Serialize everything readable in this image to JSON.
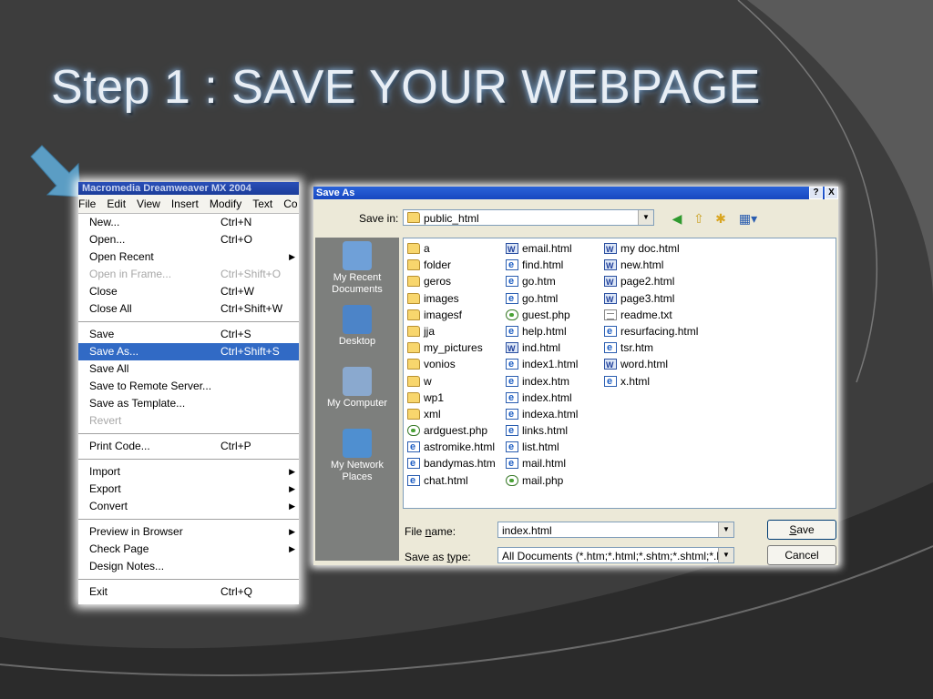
{
  "slide": {
    "title": "Step 1 : SAVE YOUR WEBPAGE"
  },
  "menu": {
    "app_title": "Macromedia Dreamweaver MX 2004",
    "menubar": [
      "File",
      "Edit",
      "View",
      "Insert",
      "Modify",
      "Text",
      "Co"
    ],
    "groups": [
      [
        {
          "label": "New...",
          "shortcut": "Ctrl+N"
        },
        {
          "label": "Open...",
          "shortcut": "Ctrl+O"
        },
        {
          "label": "Open Recent",
          "shortcut": "",
          "submenu": true
        },
        {
          "label": "Open in Frame...",
          "shortcut": "Ctrl+Shift+O",
          "disabled": true
        },
        {
          "label": "Close",
          "shortcut": "Ctrl+W"
        },
        {
          "label": "Close All",
          "shortcut": "Ctrl+Shift+W"
        }
      ],
      [
        {
          "label": "Save",
          "shortcut": "Ctrl+S"
        },
        {
          "label": "Save As...",
          "shortcut": "Ctrl+Shift+S",
          "selected": true
        },
        {
          "label": "Save All",
          "shortcut": ""
        },
        {
          "label": "Save to Remote Server...",
          "shortcut": ""
        },
        {
          "label": "Save as Template...",
          "shortcut": ""
        },
        {
          "label": "Revert",
          "shortcut": "",
          "disabled": true
        }
      ],
      [
        {
          "label": "Print Code...",
          "shortcut": "Ctrl+P"
        }
      ],
      [
        {
          "label": "Import",
          "shortcut": "",
          "submenu": true
        },
        {
          "label": "Export",
          "shortcut": "",
          "submenu": true
        },
        {
          "label": "Convert",
          "shortcut": "",
          "submenu": true
        }
      ],
      [
        {
          "label": "Preview in Browser",
          "shortcut": "",
          "submenu": true
        },
        {
          "label": "Check Page",
          "shortcut": "",
          "submenu": true
        },
        {
          "label": "Design Notes...",
          "shortcut": ""
        }
      ],
      [
        {
          "label": "Exit",
          "shortcut": "Ctrl+Q"
        }
      ]
    ]
  },
  "dialog": {
    "title": "Save As",
    "title_buttons": [
      "?",
      "X"
    ],
    "save_in_label": "Save in:",
    "save_in_value": "public_html",
    "places": [
      {
        "label": "My Recent Documents",
        "icon": "recent-documents-icon"
      },
      {
        "label": "Desktop",
        "icon": "desktop-icon"
      },
      {
        "label": "My Computer",
        "icon": "my-computer-icon"
      },
      {
        "label": "My Network Places",
        "icon": "network-places-icon"
      }
    ],
    "files": [
      [
        {
          "name": "a",
          "type": "folder"
        },
        {
          "name": "folder",
          "type": "folder"
        },
        {
          "name": "geros",
          "type": "folder"
        },
        {
          "name": "images",
          "type": "folder"
        },
        {
          "name": "imagesf",
          "type": "folder"
        },
        {
          "name": "jja",
          "type": "folder"
        },
        {
          "name": "my_pictures",
          "type": "folder"
        },
        {
          "name": "vonios",
          "type": "folder"
        },
        {
          "name": "w",
          "type": "folder"
        },
        {
          "name": "wp1",
          "type": "folder"
        },
        {
          "name": "xml",
          "type": "folder"
        },
        {
          "name": "ardguest.php",
          "type": "php"
        },
        {
          "name": "astromike.html",
          "type": "html"
        },
        {
          "name": "bandymas.htm",
          "type": "html"
        },
        {
          "name": "chat.html",
          "type": "html"
        }
      ],
      [
        {
          "name": "email.html",
          "type": "word"
        },
        {
          "name": "find.html",
          "type": "html"
        },
        {
          "name": "go.htm",
          "type": "html"
        },
        {
          "name": "go.html",
          "type": "html"
        },
        {
          "name": "guest.php",
          "type": "php"
        },
        {
          "name": "help.html",
          "type": "html"
        },
        {
          "name": "ind.html",
          "type": "word"
        },
        {
          "name": "index1.html",
          "type": "html"
        },
        {
          "name": "index.htm",
          "type": "html"
        },
        {
          "name": "index.html",
          "type": "html"
        },
        {
          "name": "indexa.html",
          "type": "html"
        },
        {
          "name": "links.html",
          "type": "html"
        },
        {
          "name": "list.html",
          "type": "html"
        },
        {
          "name": "mail.html",
          "type": "html"
        },
        {
          "name": "mail.php",
          "type": "php"
        }
      ],
      [
        {
          "name": "my doc.html",
          "type": "word"
        },
        {
          "name": "new.html",
          "type": "word"
        },
        {
          "name": "page2.html",
          "type": "word"
        },
        {
          "name": "page3.html",
          "type": "word"
        },
        {
          "name": "readme.txt",
          "type": "txt"
        },
        {
          "name": "resurfacing.html",
          "type": "html"
        },
        {
          "name": "tsr.htm",
          "type": "html"
        },
        {
          "name": "word.html",
          "type": "word"
        },
        {
          "name": "x.html",
          "type": "html"
        }
      ]
    ],
    "file_name_label": "File name:",
    "file_name_value": "index.html",
    "save_type_label": "Save as type:",
    "save_type_value": "All Documents (*.htm;*.html;*.shtm;*.shtml;*.hta;*",
    "save_button": "Save",
    "cancel_button": "Cancel"
  },
  "colors": {
    "background": "#3b3b3b",
    "menu_selected": "#316ac5",
    "dialog_bg": "#ece9d8",
    "arrow": "#5b9dc4"
  }
}
